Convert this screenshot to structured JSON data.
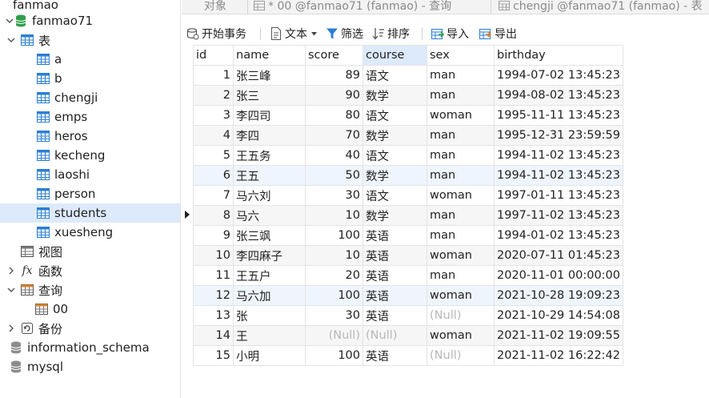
{
  "sidebar": {
    "connection": "fanmao",
    "database": "fanmao71",
    "tables_group": "表",
    "tables": [
      "a",
      "b",
      "chengji",
      "emps",
      "heros",
      "kecheng",
      "laoshi",
      "person",
      "students",
      "xuesheng"
    ],
    "selected_table": "students",
    "views_group": "视图",
    "functions_group": "函数",
    "queries_group": "查询",
    "queries": [
      "00"
    ],
    "backup_group": "备份",
    "other_databases": [
      "information_schema",
      "mysql"
    ]
  },
  "tabs": {
    "objects": "对象",
    "query_tab": "* 00 @fanmao71 (fanmao) - 查询",
    "table_tab": "chengji @fanmao71 (fanmao) - 表"
  },
  "toolbar": {
    "begin_transaction": "开始事务",
    "text": "文本",
    "filter": "筛选",
    "sort": "排序",
    "import": "导入",
    "export": "导出"
  },
  "grid": {
    "columns": [
      "id",
      "name",
      "score",
      "course",
      "sex",
      "birthday"
    ],
    "sorted_column": "course",
    "current_row_index": 7,
    "null_text": "(Null)",
    "rows": [
      [
        "1",
        "张三峰",
        "89",
        "语文",
        "man",
        "1994-07-02 13:45:23"
      ],
      [
        "2",
        "张三",
        "90",
        "数学",
        "man",
        "1994-08-02 13:45:23"
      ],
      [
        "3",
        "李四司",
        "80",
        "语文",
        "woman",
        "1995-11-11 13:45:23"
      ],
      [
        "4",
        "李四",
        "70",
        "数学",
        "man",
        "1995-12-31 23:59:59"
      ],
      [
        "5",
        "王五务",
        "40",
        "语文",
        "man",
        "1994-11-02 13:45:23"
      ],
      [
        "6",
        "王五",
        "50",
        "数学",
        "man",
        "1994-11-02 13:45:23"
      ],
      [
        "7",
        "马六刘",
        "30",
        "语文",
        "woman",
        "1997-01-11 13:45:23"
      ],
      [
        "8",
        "马六",
        "10",
        "数学",
        "man",
        "1997-11-02 13:45:23"
      ],
      [
        "9",
        "张三飒",
        "100",
        "英语",
        "man",
        "1994-01-02 13:45:23"
      ],
      [
        "10",
        "李四麻子",
        "10",
        "英语",
        "woman",
        "2020-07-11 01:45:23"
      ],
      [
        "11",
        "王五户",
        "20",
        "英语",
        "man",
        "2020-11-01 00:00:00"
      ],
      [
        "12",
        "马六加",
        "100",
        "英语",
        "woman",
        "2021-10-28 19:09:23"
      ],
      [
        "13",
        "张",
        "30",
        "英语",
        null,
        "2021-10-29 14:54:08"
      ],
      [
        "14",
        "王",
        null,
        null,
        "woman",
        "2021-11-02 19:09:55"
      ],
      [
        "15",
        "小明",
        "100",
        "英语",
        null,
        "2021-11-02 16:22:42"
      ]
    ]
  },
  "colors": {
    "selection": "#dceafb",
    "table_icon": "#2a7fd4",
    "db_icon": "#2e9e4a",
    "null_text": "#b8b8b8"
  }
}
